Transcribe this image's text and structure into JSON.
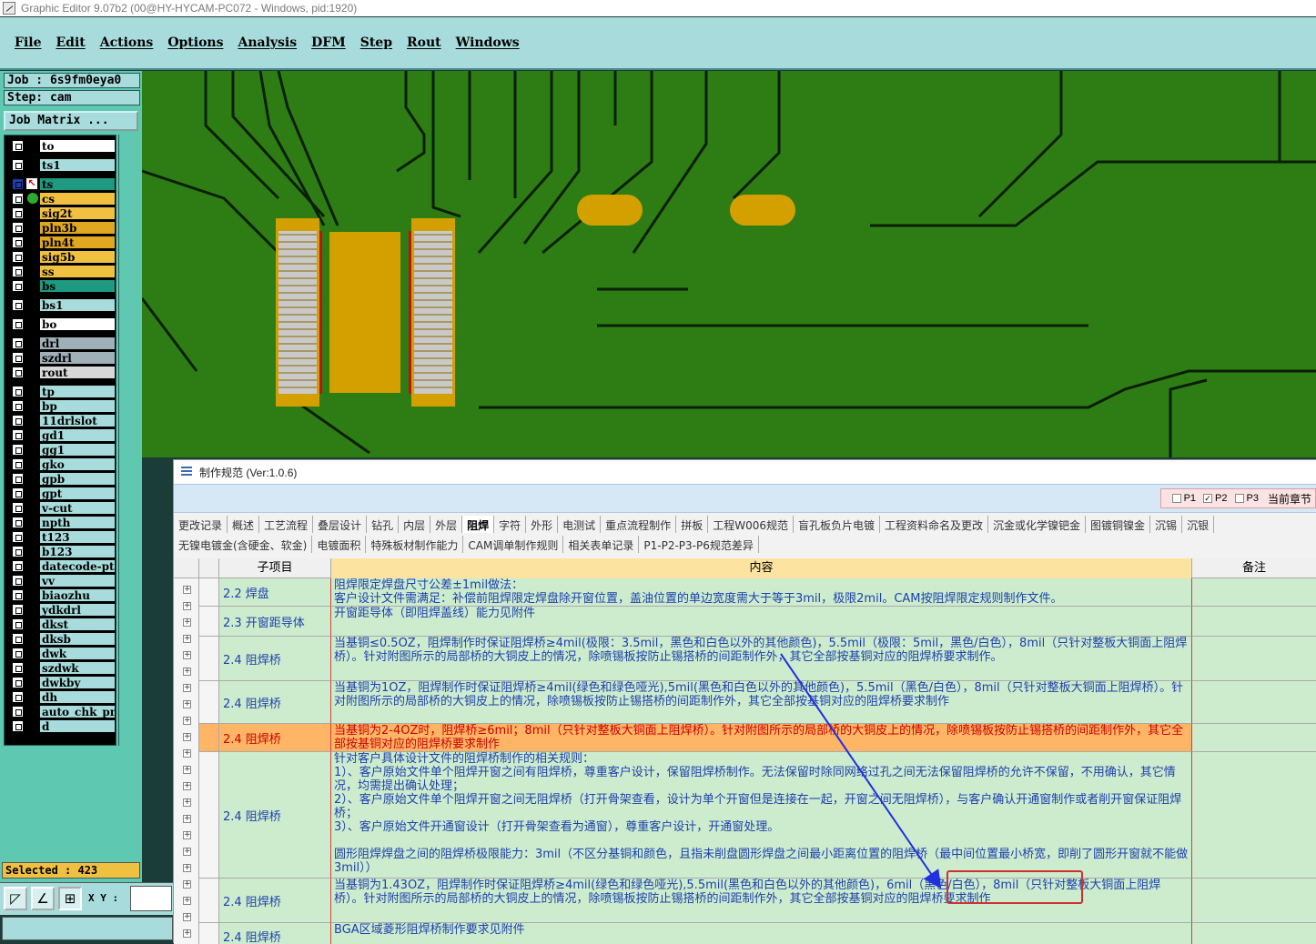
{
  "titlebar": {
    "text": "Graphic Editor 9.07b2 (00@HY-HYCAM-PC072 - Windows, pid:1920)"
  },
  "menu": [
    "File",
    "Edit",
    "Actions",
    "Options",
    "Analysis",
    "DFM",
    "Step",
    "Rout",
    "Windows"
  ],
  "job": {
    "job": "Job : 6s9fm0eya0",
    "step": "Step: cam",
    "matrix_button": "Job Matrix ..."
  },
  "layers": [
    {
      "name": "to",
      "color": "#ffffff"
    },
    {
      "name": "ts1",
      "color": "#a8dcdc"
    },
    {
      "name": "ts",
      "color": "#1e9a80"
    },
    {
      "name": "cs",
      "color": "#f0c040"
    },
    {
      "name": "sig2t",
      "color": "#f0c040"
    },
    {
      "name": "pln3b",
      "color": "#e0a820"
    },
    {
      "name": "pln4t",
      "color": "#e0a820"
    },
    {
      "name": "sig5b",
      "color": "#f0c040"
    },
    {
      "name": "ss",
      "color": "#f0c040"
    },
    {
      "name": "bs",
      "color": "#1e9a80"
    },
    {
      "name": "bs1",
      "color": "#a8dcdc"
    },
    {
      "name": "bo",
      "color": "#ffffff"
    },
    {
      "name": "drl",
      "color": "#a0b0b8"
    },
    {
      "name": "szdrl",
      "color": "#a0b0b8"
    },
    {
      "name": "rout",
      "color": "#d8d8d8"
    },
    {
      "name": "tp",
      "color": "#a8dcdc"
    },
    {
      "name": "bp",
      "color": "#a8dcdc"
    },
    {
      "name": "11drlslot",
      "color": "#a8dcdc"
    },
    {
      "name": "gd1",
      "color": "#a8dcdc"
    },
    {
      "name": "gg1",
      "color": "#a8dcdc"
    },
    {
      "name": "gko",
      "color": "#a8dcdc"
    },
    {
      "name": "gpb",
      "color": "#a8dcdc"
    },
    {
      "name": "gpt",
      "color": "#a8dcdc"
    },
    {
      "name": "v-cut",
      "color": "#a8dcdc"
    },
    {
      "name": "npth",
      "color": "#a8dcdc"
    },
    {
      "name": "t123",
      "color": "#a8dcdc"
    },
    {
      "name": "b123",
      "color": "#a8dcdc"
    },
    {
      "name": "datecode-pt",
      "color": "#a8dcdc"
    },
    {
      "name": "vv",
      "color": "#a8dcdc"
    },
    {
      "name": "biaozhu",
      "color": "#a8dcdc"
    },
    {
      "name": "ydkdrl",
      "color": "#a8dcdc"
    },
    {
      "name": "dkst",
      "color": "#a8dcdc"
    },
    {
      "name": "dksb",
      "color": "#a8dcdc"
    },
    {
      "name": "dwk",
      "color": "#a8dcdc"
    },
    {
      "name": "szdwk",
      "color": "#a8dcdc"
    },
    {
      "name": "dwkby",
      "color": "#a8dcdc"
    },
    {
      "name": "dh",
      "color": "#a8dcdc"
    },
    {
      "name": "auto_chk_pn",
      "color": "#a8dcdc"
    },
    {
      "name": "d",
      "color": "#a8dcdc"
    }
  ],
  "status": {
    "selected": "Selected : 423",
    "xy_label": "X Y :"
  },
  "dialog": {
    "title": "制作规范 (Ver:1.0.6)",
    "checks": [
      {
        "label": "P1",
        "checked": false
      },
      {
        "label": "P2",
        "checked": true
      },
      {
        "label": "P3",
        "checked": false
      }
    ],
    "chapter_label": "当前章节",
    "tabs1": [
      "更改记录",
      "概述",
      "工艺流程",
      "叠层设计",
      "钻孔",
      "内层",
      "外层",
      "阻焊",
      "字符",
      "外形",
      "电测试",
      "重点流程制作",
      "拼板",
      "工程W006规范",
      "盲孔板负片电镀",
      "工程资料命名及更改",
      "沉金或化学镍钯金",
      "图镀铜镍金",
      "沉锡",
      "沉银"
    ],
    "tabs2": [
      "无镍电镀金(含硬金、软金)",
      "电镀面积",
      "特殊板材制作能力",
      "CAM调单制作规则",
      "相关表单记录",
      "P1-P2-P3-P6规范差异"
    ],
    "active_tab": "阻焊",
    "headers": {
      "sub": "子项目",
      "content": "内容",
      "note": "备注"
    },
    "rows": [
      {
        "sub": "2.2 焊盘",
        "text": "阻焊限定焊盘尺寸公差±1mil做法：\n客户设计文件需满足：补偿前阻焊限定焊盘除开窗位置，盖油位置的单边宽度需大于等于3mil，极限2mil。CAM按阻焊限定规则制作文件。"
      },
      {
        "sub": "2.3 开窗距导体",
        "text": "开窗距导体（即阻焊盖线）能力见附件"
      },
      {
        "sub": "2.4 阻焊桥",
        "text": "当基铜≤0.5OZ，阻焊制作时保证阻焊桥≥4mil(极限：3.5mil，黑色和白色以外的其他颜色)，5.5mil（极限：5mil，黑色/白色），8mil（只针对整板大铜面上阻焊桥）。针对附图所示的局部桥的大铜皮上的情况，除喷锡板按防止锡搭桥的间距制作外，其它全部按基铜对应的阻焊桥要求制作。"
      },
      {
        "sub": "2.4 阻焊桥",
        "text": "当基铜为1OZ，阻焊制作时保证阻焊桥≥4mil(绿色和绿色哑光),5mil(黑色和白色以外的其他颜色)，5.5mil（黑色/白色），8mil（只针对整板大铜面上阻焊桥）。针对附图所示的局部桥的大铜皮上的情况，除喷锡板按防止锡搭桥的间距制作外，其它全部按基铜对应的阻焊桥要求制作"
      },
      {
        "sub": "2.4 阻焊桥",
        "text": "当基铜为2-4OZ时，阻焊桥≥6mil；8mil（只针对整板大铜面上阻焊桥）。针对附图所示的局部桥的大铜皮上的情况，除喷锡板按防止锡搭桥的间距制作外，其它全部按基铜对应的阻焊桥要求制作",
        "highlight": true
      },
      {
        "sub": "2.4 阻焊桥",
        "text": "针对客户具体设计文件的阻焊桥制作的相关规则：\n1）、客户原始文件单个阻焊开窗之间有阻焊桥，尊重客户设计，保留阻焊桥制作。无法保留时除同网络过孔之间无法保留阻焊桥的允许不保留，不用确认，其它情况，均需提出确认处理；\n2）、客户原始文件单个阻焊开窗之间无阻焊桥（打开骨架查看，设计为单个开窗但是连接在一起，开窗之间无阻焊桥），与客户确认开通窗制作或者削开窗保证阻焊桥；\n3）、客户原始文件开通窗设计（打开骨架查看为通窗），尊重客户设计，开通窗处理。\n\n圆形阻焊焊盘之间的阻焊桥极限能力：3mil（不区分基铜和颜色，且指未削盘圆形焊盘之间最小距离位置的阻焊桥（最中间位置最小桥宽，即削了圆形开窗就不能做3mil））"
      },
      {
        "sub": "2.4 阻焊桥",
        "text": "当基铜为1.43OZ，阻焊制作时保证阻焊桥≥4mil(绿色和绿色哑光),5.5mil(黑色和白色以外的其他颜色)，6mil（黑色/白色），8mil（只针对整板大铜面上阻焊桥）。针对附图所示的局部桥的大铜皮上的情况，除喷锡板按防止锡搭桥的间距制作外，其它全部按基铜对应的阻焊桥要求制作"
      },
      {
        "sub": "2.4 阻焊桥",
        "text": "BGA区域菱形阻焊桥制作要求见附件"
      }
    ]
  }
}
